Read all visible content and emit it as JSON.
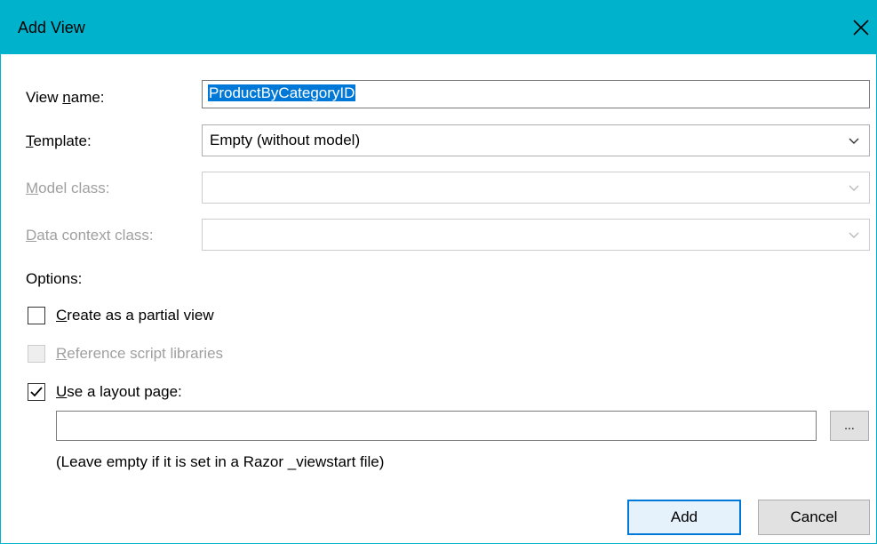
{
  "window": {
    "title": "Add View"
  },
  "form": {
    "view_name": {
      "label_before": "View ",
      "label_accel": "n",
      "label_after": "ame:",
      "value": "ProductByCategoryID"
    },
    "template": {
      "label_accel": "T",
      "label_after": "emplate:",
      "value": "Empty (without model)"
    },
    "model_class": {
      "label_accel": "M",
      "label_after": "odel class:",
      "value": ""
    },
    "data_context_class": {
      "label_accel": "D",
      "label_after": "ata context class:",
      "value": ""
    }
  },
  "options": {
    "heading": "Options:",
    "partial_view": {
      "label_accel": "C",
      "label_after": "reate as a partial view",
      "checked": false
    },
    "reference_scripts": {
      "label_accel": "R",
      "label_after": "eference script libraries",
      "checked": false,
      "disabled": true
    },
    "layout_page": {
      "label_accel": "U",
      "label_after": "se a layout page:",
      "checked": true,
      "path_value": "",
      "browse_label": "...",
      "hint": "(Leave empty if it is set in a Razor _viewstart file)"
    }
  },
  "buttons": {
    "add": "Add",
    "cancel": "Cancel"
  },
  "colors": {
    "titlebar": "#00b2cc",
    "selection": "#0078d7"
  }
}
